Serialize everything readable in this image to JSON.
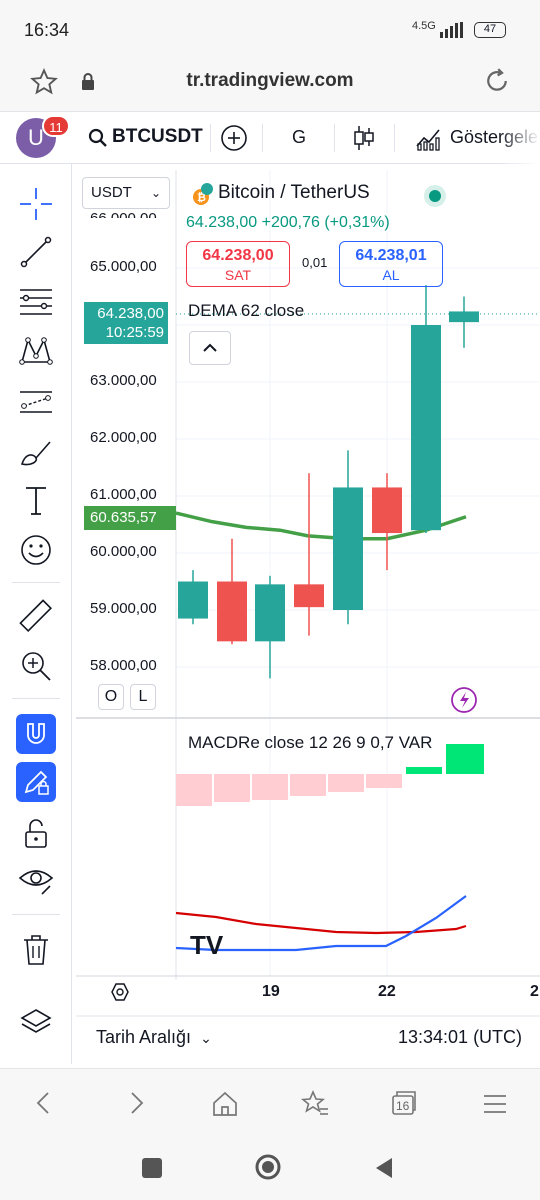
{
  "status_bar": {
    "time": "16:34",
    "network": "4.5G",
    "battery": "47"
  },
  "browser": {
    "url": "tr.tradingview.com",
    "tab_count": "16"
  },
  "toolbar": {
    "avatar_letter": "U",
    "notification_count": "11",
    "symbol": "BTCUSDT",
    "interval": "G",
    "indicators_label": "Göstergeler"
  },
  "chart": {
    "currency_select": "USDT",
    "title": "Bitcoin / TetherUS",
    "last_price_line": "64.238,00 +200,76 (+0,31%)",
    "sell": {
      "price": "64.238,00",
      "label": "SAT"
    },
    "buy": {
      "price": "64.238,01",
      "label": "AL"
    },
    "spread": "0,01",
    "dema_label": "DEMA 62 close",
    "current_price_tag": "64.238,00",
    "current_time_tag": "10:25:59",
    "dema_value_tag": "60.635,57",
    "price_axis": [
      "65.000,00",
      "63.000,00",
      "62.000,00",
      "61.000,00",
      "60.000,00",
      "59.000,00",
      "58.000,00"
    ],
    "macd_label": "MACDRe close 12 26 9 0,7 VAR",
    "time_axis": [
      "19",
      "22",
      "2"
    ],
    "ol_buttons": [
      "O",
      "L"
    ],
    "date_range_label": "Tarih Aralığı",
    "clock": "13:34:01 (UTC)",
    "colors": {
      "up": "#26a69a",
      "down": "#ef5350",
      "dema": "#43a047",
      "macd": "#2962ff",
      "signal": "#d50000"
    }
  },
  "chart_data": {
    "type": "candlestick",
    "title": "Bitcoin / TetherUS",
    "candles": [
      {
        "open": 58850,
        "high": 59700,
        "low": 58750,
        "close": 59500
      },
      {
        "open": 59500,
        "high": 60250,
        "low": 58400,
        "close": 58450
      },
      {
        "open": 58450,
        "high": 59600,
        "low": 57800,
        "close": 59450
      },
      {
        "open": 59450,
        "high": 61400,
        "low": 58550,
        "close": 59050
      },
      {
        "open": 59000,
        "high": 61800,
        "low": 58750,
        "close": 61150
      },
      {
        "open": 61150,
        "high": 61400,
        "low": 59700,
        "close": 60350
      },
      {
        "open": 60400,
        "high": 64700,
        "low": 60350,
        "close": 64000
      },
      {
        "open": 64050,
        "high": 64500,
        "low": 63600,
        "close": 64238
      }
    ],
    "dema": [
      60700,
      60550,
      60450,
      60400,
      60300,
      60250,
      60250,
      60400,
      60636
    ],
    "ylim": [
      57500,
      65500
    ]
  }
}
